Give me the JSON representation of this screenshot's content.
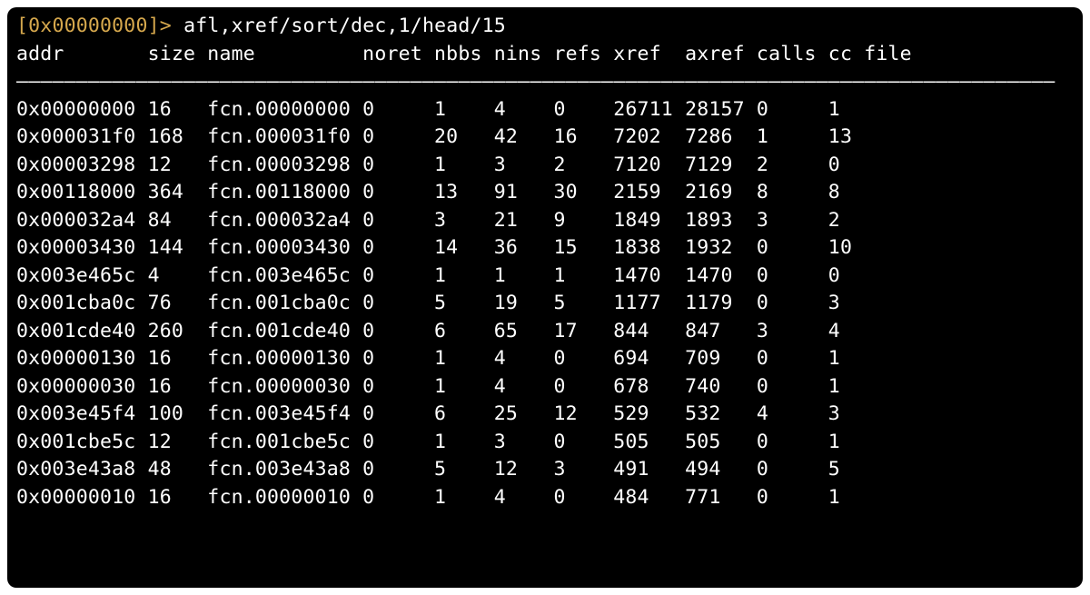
{
  "prompt": {
    "lbracket": "[",
    "address": "0x00000000",
    "rbracket": "]",
    "gt": ">",
    "command": " afl,xref/sort/dec,1/head/15"
  },
  "columns": [
    "addr",
    "size",
    "name",
    "noret",
    "nbbs",
    "nins",
    "refs",
    "xref",
    "axref",
    "calls",
    "cc",
    "file"
  ],
  "widths": [
    11,
    5,
    13,
    6,
    5,
    5,
    5,
    6,
    6,
    6,
    3,
    4
  ],
  "separator_char": "―",
  "separator_len": 87,
  "rows": [
    {
      "addr": "0x00000000",
      "size": "16",
      "name": "fcn.00000000",
      "noret": "0",
      "nbbs": "1",
      "nins": "4",
      "refs": "0",
      "xref": "26711",
      "axref": "28157",
      "calls": "0",
      "cc": "1",
      "file": ""
    },
    {
      "addr": "0x000031f0",
      "size": "168",
      "name": "fcn.000031f0",
      "noret": "0",
      "nbbs": "20",
      "nins": "42",
      "refs": "16",
      "xref": "7202",
      "axref": "7286",
      "calls": "1",
      "cc": "13",
      "file": ""
    },
    {
      "addr": "0x00003298",
      "size": "12",
      "name": "fcn.00003298",
      "noret": "0",
      "nbbs": "1",
      "nins": "3",
      "refs": "2",
      "xref": "7120",
      "axref": "7129",
      "calls": "2",
      "cc": "0",
      "file": ""
    },
    {
      "addr": "0x00118000",
      "size": "364",
      "name": "fcn.00118000",
      "noret": "0",
      "nbbs": "13",
      "nins": "91",
      "refs": "30",
      "xref": "2159",
      "axref": "2169",
      "calls": "8",
      "cc": "8",
      "file": ""
    },
    {
      "addr": "0x000032a4",
      "size": "84",
      "name": "fcn.000032a4",
      "noret": "0",
      "nbbs": "3",
      "nins": "21",
      "refs": "9",
      "xref": "1849",
      "axref": "1893",
      "calls": "3",
      "cc": "2",
      "file": ""
    },
    {
      "addr": "0x00003430",
      "size": "144",
      "name": "fcn.00003430",
      "noret": "0",
      "nbbs": "14",
      "nins": "36",
      "refs": "15",
      "xref": "1838",
      "axref": "1932",
      "calls": "0",
      "cc": "10",
      "file": ""
    },
    {
      "addr": "0x003e465c",
      "size": "4",
      "name": "fcn.003e465c",
      "noret": "0",
      "nbbs": "1",
      "nins": "1",
      "refs": "1",
      "xref": "1470",
      "axref": "1470",
      "calls": "0",
      "cc": "0",
      "file": ""
    },
    {
      "addr": "0x001cba0c",
      "size": "76",
      "name": "fcn.001cba0c",
      "noret": "0",
      "nbbs": "5",
      "nins": "19",
      "refs": "5",
      "xref": "1177",
      "axref": "1179",
      "calls": "0",
      "cc": "3",
      "file": ""
    },
    {
      "addr": "0x001cde40",
      "size": "260",
      "name": "fcn.001cde40",
      "noret": "0",
      "nbbs": "6",
      "nins": "65",
      "refs": "17",
      "xref": "844",
      "axref": "847",
      "calls": "3",
      "cc": "4",
      "file": ""
    },
    {
      "addr": "0x00000130",
      "size": "16",
      "name": "fcn.00000130",
      "noret": "0",
      "nbbs": "1",
      "nins": "4",
      "refs": "0",
      "xref": "694",
      "axref": "709",
      "calls": "0",
      "cc": "1",
      "file": ""
    },
    {
      "addr": "0x00000030",
      "size": "16",
      "name": "fcn.00000030",
      "noret": "0",
      "nbbs": "1",
      "nins": "4",
      "refs": "0",
      "xref": "678",
      "axref": "740",
      "calls": "0",
      "cc": "1",
      "file": ""
    },
    {
      "addr": "0x003e45f4",
      "size": "100",
      "name": "fcn.003e45f4",
      "noret": "0",
      "nbbs": "6",
      "nins": "25",
      "refs": "12",
      "xref": "529",
      "axref": "532",
      "calls": "4",
      "cc": "3",
      "file": ""
    },
    {
      "addr": "0x001cbe5c",
      "size": "12",
      "name": "fcn.001cbe5c",
      "noret": "0",
      "nbbs": "1",
      "nins": "3",
      "refs": "0",
      "xref": "505",
      "axref": "505",
      "calls": "0",
      "cc": "1",
      "file": ""
    },
    {
      "addr": "0x003e43a8",
      "size": "48",
      "name": "fcn.003e43a8",
      "noret": "0",
      "nbbs": "5",
      "nins": "12",
      "refs": "3",
      "xref": "491",
      "axref": "494",
      "calls": "0",
      "cc": "5",
      "file": ""
    },
    {
      "addr": "0x00000010",
      "size": "16",
      "name": "fcn.00000010",
      "noret": "0",
      "nbbs": "1",
      "nins": "4",
      "refs": "0",
      "xref": "484",
      "axref": "771",
      "calls": "0",
      "cc": "1",
      "file": ""
    }
  ]
}
